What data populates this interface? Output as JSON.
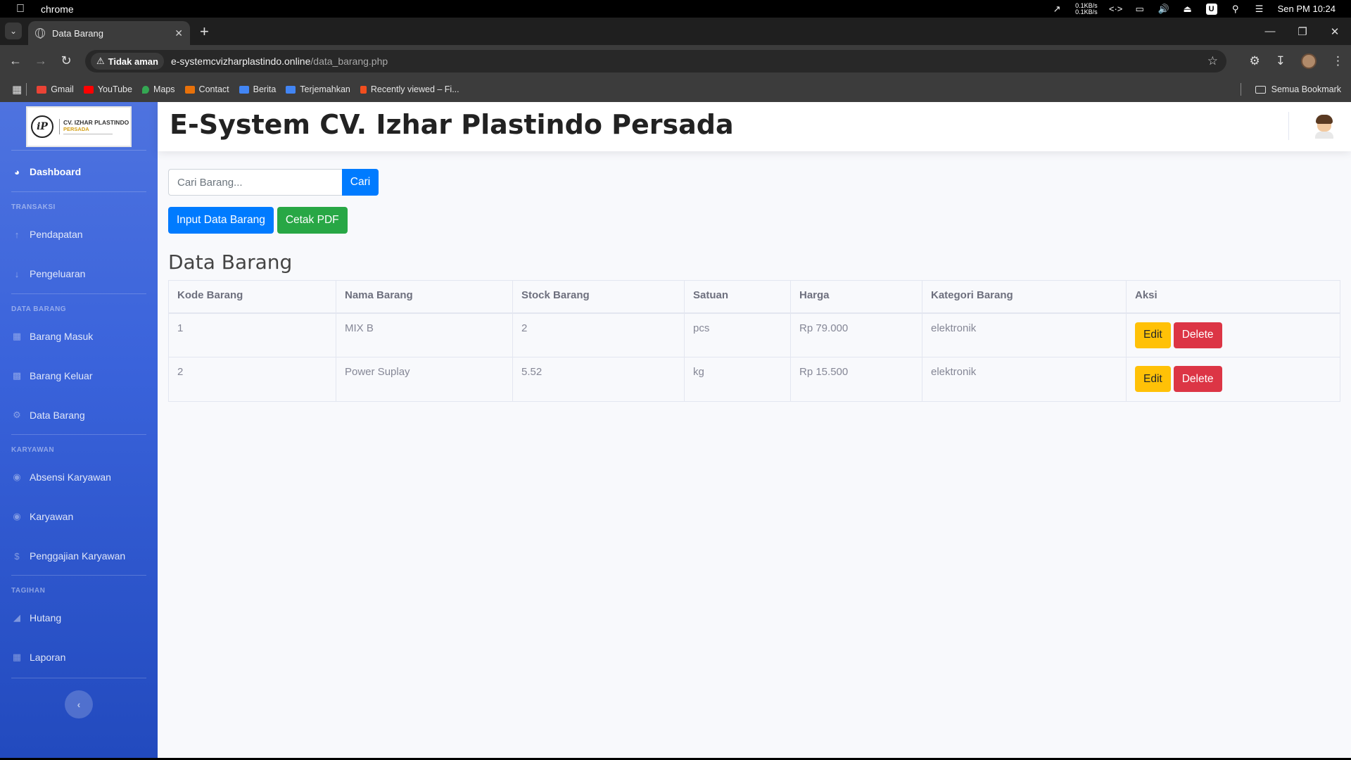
{
  "menubar": {
    "app_name": "chrome",
    "net_up": "0.1KB/s",
    "net_down": "0.1KB/s",
    "clock": "Sen PM 10:24"
  },
  "browser": {
    "tab_title": "Data Barang",
    "security_label": "Tidak aman",
    "url_host": "e-systemcvizharplastindo.online",
    "url_path": "/data_barang.php",
    "bookmarks": [
      {
        "label": "Gmail",
        "color": "#ea4335"
      },
      {
        "label": "YouTube",
        "color": "#ff0000"
      },
      {
        "label": "Maps",
        "color": "#34a853"
      },
      {
        "label": "Contact",
        "color": "#e8710a"
      },
      {
        "label": "Berita",
        "color": "#4285f4"
      },
      {
        "label": "Terjemahkan",
        "color": "#4285f4"
      },
      {
        "label": "Recently viewed – Fi...",
        "color": "#f24e1e"
      }
    ],
    "all_bookmarks": "Semua Bookmark"
  },
  "sidebar": {
    "brand_line1": "CV. IZHAR PLASTINDO",
    "brand_line2": "PERSADA",
    "dashboard": "Dashboard",
    "headings": {
      "transaksi": "TRANSAKSI",
      "data_barang": "DATA BARANG",
      "karyawan": "KARYAWAN",
      "tagihan": "TAGIHAN"
    },
    "items": {
      "pendapatan": "Pendapatan",
      "pengeluaran": "Pengeluaran",
      "barang_masuk": "Barang Masuk",
      "barang_keluar": "Barang Keluar",
      "data_barang": "Data Barang",
      "absensi": "Absensi Karyawan",
      "karyawan": "Karyawan",
      "penggajian": "Penggajian Karyawan",
      "hutang": "Hutang",
      "laporan": "Laporan"
    },
    "colors": {
      "gradient_top": "#4e73df",
      "gradient_bottom": "#224abe"
    }
  },
  "topbar": {
    "title": "E-System CV. Izhar Plastindo Persada"
  },
  "main": {
    "search_placeholder": "Cari Barang...",
    "search_button": "Cari",
    "input_button": "Input Data Barang",
    "pdf_button": "Cetak PDF",
    "section_title": "Data Barang",
    "table": {
      "headers": [
        "Kode Barang",
        "Nama Barang",
        "Stock Barang",
        "Satuan",
        "Harga",
        "Kategori Barang",
        "Aksi"
      ],
      "rows": [
        {
          "kode": "1",
          "nama": "MIX B",
          "stock": "2",
          "satuan": "pcs",
          "harga": "Rp 79.000",
          "kategori": "elektronik"
        },
        {
          "kode": "2",
          "nama": "Power Suplay",
          "stock": "5.52",
          "satuan": "kg",
          "harga": "Rp 15.500",
          "kategori": "elektronik"
        }
      ],
      "edit_label": "Edit",
      "delete_label": "Delete"
    },
    "colors": {
      "primary": "#007bff",
      "success": "#28a745",
      "warning": "#ffc107",
      "danger": "#dc3545"
    }
  }
}
